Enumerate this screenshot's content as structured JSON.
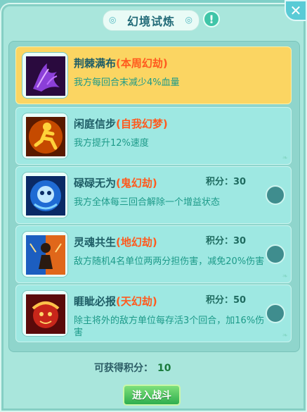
{
  "header": {
    "title": "幻境试炼"
  },
  "items": [
    {
      "name": "荆棘满布",
      "tag": "(本周幻劫)",
      "desc": "我方每回合末减少4%血量",
      "score": "",
      "icon": "thorn-claw-icon",
      "active": true
    },
    {
      "name": "闲庭信步",
      "tag": "(自我幻梦)",
      "desc": "我方提升12%速度",
      "score": "",
      "icon": "running-figure-icon",
      "active": false
    },
    {
      "name": "碌碌无为",
      "tag": "(鬼幻劫)",
      "desc": "我方全体每三回合解除一个增益状态",
      "score": "积分：30",
      "icon": "ghost-face-icon",
      "active": false
    },
    {
      "name": "灵魂共生",
      "tag": "(地幻劫)",
      "desc": "敌方随机4名单位两两分担伤害，减免20%伤害",
      "score": "积分：30",
      "icon": "twin-soul-icon",
      "active": false
    },
    {
      "name": "睚眦必报",
      "tag": "(天幻劫)",
      "desc": "除主将外的敌方单位每存活3个回合，加16%伤害",
      "score": "积分：50",
      "icon": "vengeful-beast-icon",
      "active": false
    }
  ],
  "footer": {
    "points_label": "可获得积分：",
    "points_value": "10",
    "enter_label": "进入战斗"
  },
  "colors": {
    "active_card": "#fbd562",
    "card": "#9ee8e2",
    "tag": "#ff5a1e",
    "desc": "#1d9a89",
    "button": "#2eae4e"
  }
}
